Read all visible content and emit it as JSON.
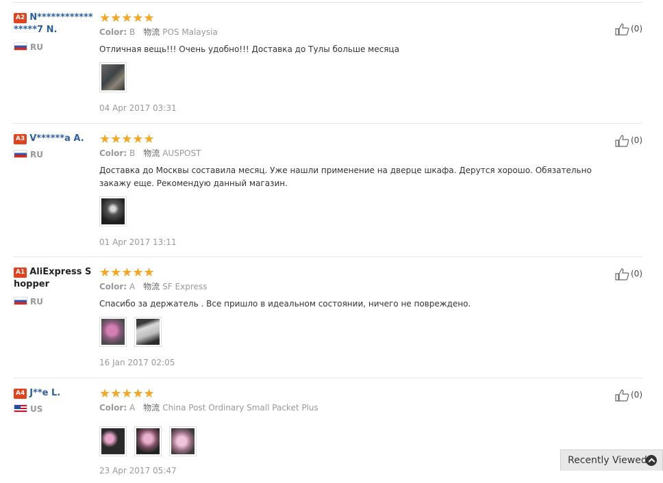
{
  "reviews": [
    {
      "level": "A2",
      "user": "N*****************7 N.",
      "country": "RU",
      "flag": "ru",
      "stars": "★★★★★",
      "color_label": "Color:",
      "color_value": "B",
      "logistics_label": "物流",
      "logistics": "POS Malaysia",
      "text": "Отличная вещь!!! Очень удобно!!! Доставка до Тулы больше месяца",
      "images": [
        "photo-holder-grey"
      ],
      "date": "04 Apr 2017 03:31",
      "helpful": "(0)"
    },
    {
      "level": "A3",
      "user": "V******a A.",
      "country": "RU",
      "flag": "ru",
      "stars": "★★★★★",
      "color_label": "Color:",
      "color_value": "B",
      "logistics_label": "物流",
      "logistics": "AUSPOST",
      "text": "Доставка до Москвы составила месяц. Уже нашли применение на дверце шкафа. Дерутся хорошо. Обязательно закажу еще. Рекомендую данный магазин.",
      "images": [
        "photo-dark-item"
      ],
      "date": "01 Apr 2017 13:11",
      "helpful": "(0)"
    },
    {
      "level": "A1",
      "user": "AliExpress Shopper",
      "country": "RU",
      "flag": "ru",
      "stars": "★★★★★",
      "color_label": "Color:",
      "color_value": "A",
      "logistics_label": "物流",
      "logistics": "SF Express",
      "text": "Спасибо за держатель . Все пришло в идеальном состоянии, ничего не повреждено.",
      "images": [
        "photo-pink-item",
        "photo-package"
      ],
      "date": "16 Jan 2017 02:05",
      "helpful": "(0)"
    },
    {
      "level": "A4",
      "user": "J**e L.",
      "country": "US",
      "flag": "us",
      "stars": "★★★★★",
      "color_label": "Color:",
      "color_value": "A",
      "logistics_label": "物流",
      "logistics": "China Post Ordinary Small Packet Plus",
      "text": "",
      "images": [
        "photo-pink-cups-1",
        "photo-pink-cups-2",
        "photo-pink-cups-3"
      ],
      "date": "23 Apr 2017 05:47",
      "helpful": "(0)"
    }
  ],
  "recently_viewed": "Recently Viewed",
  "colors": {
    "star": "#f6a623",
    "username": "#2b5ea5",
    "level_badge": "#e0431e",
    "muted": "#999999"
  }
}
